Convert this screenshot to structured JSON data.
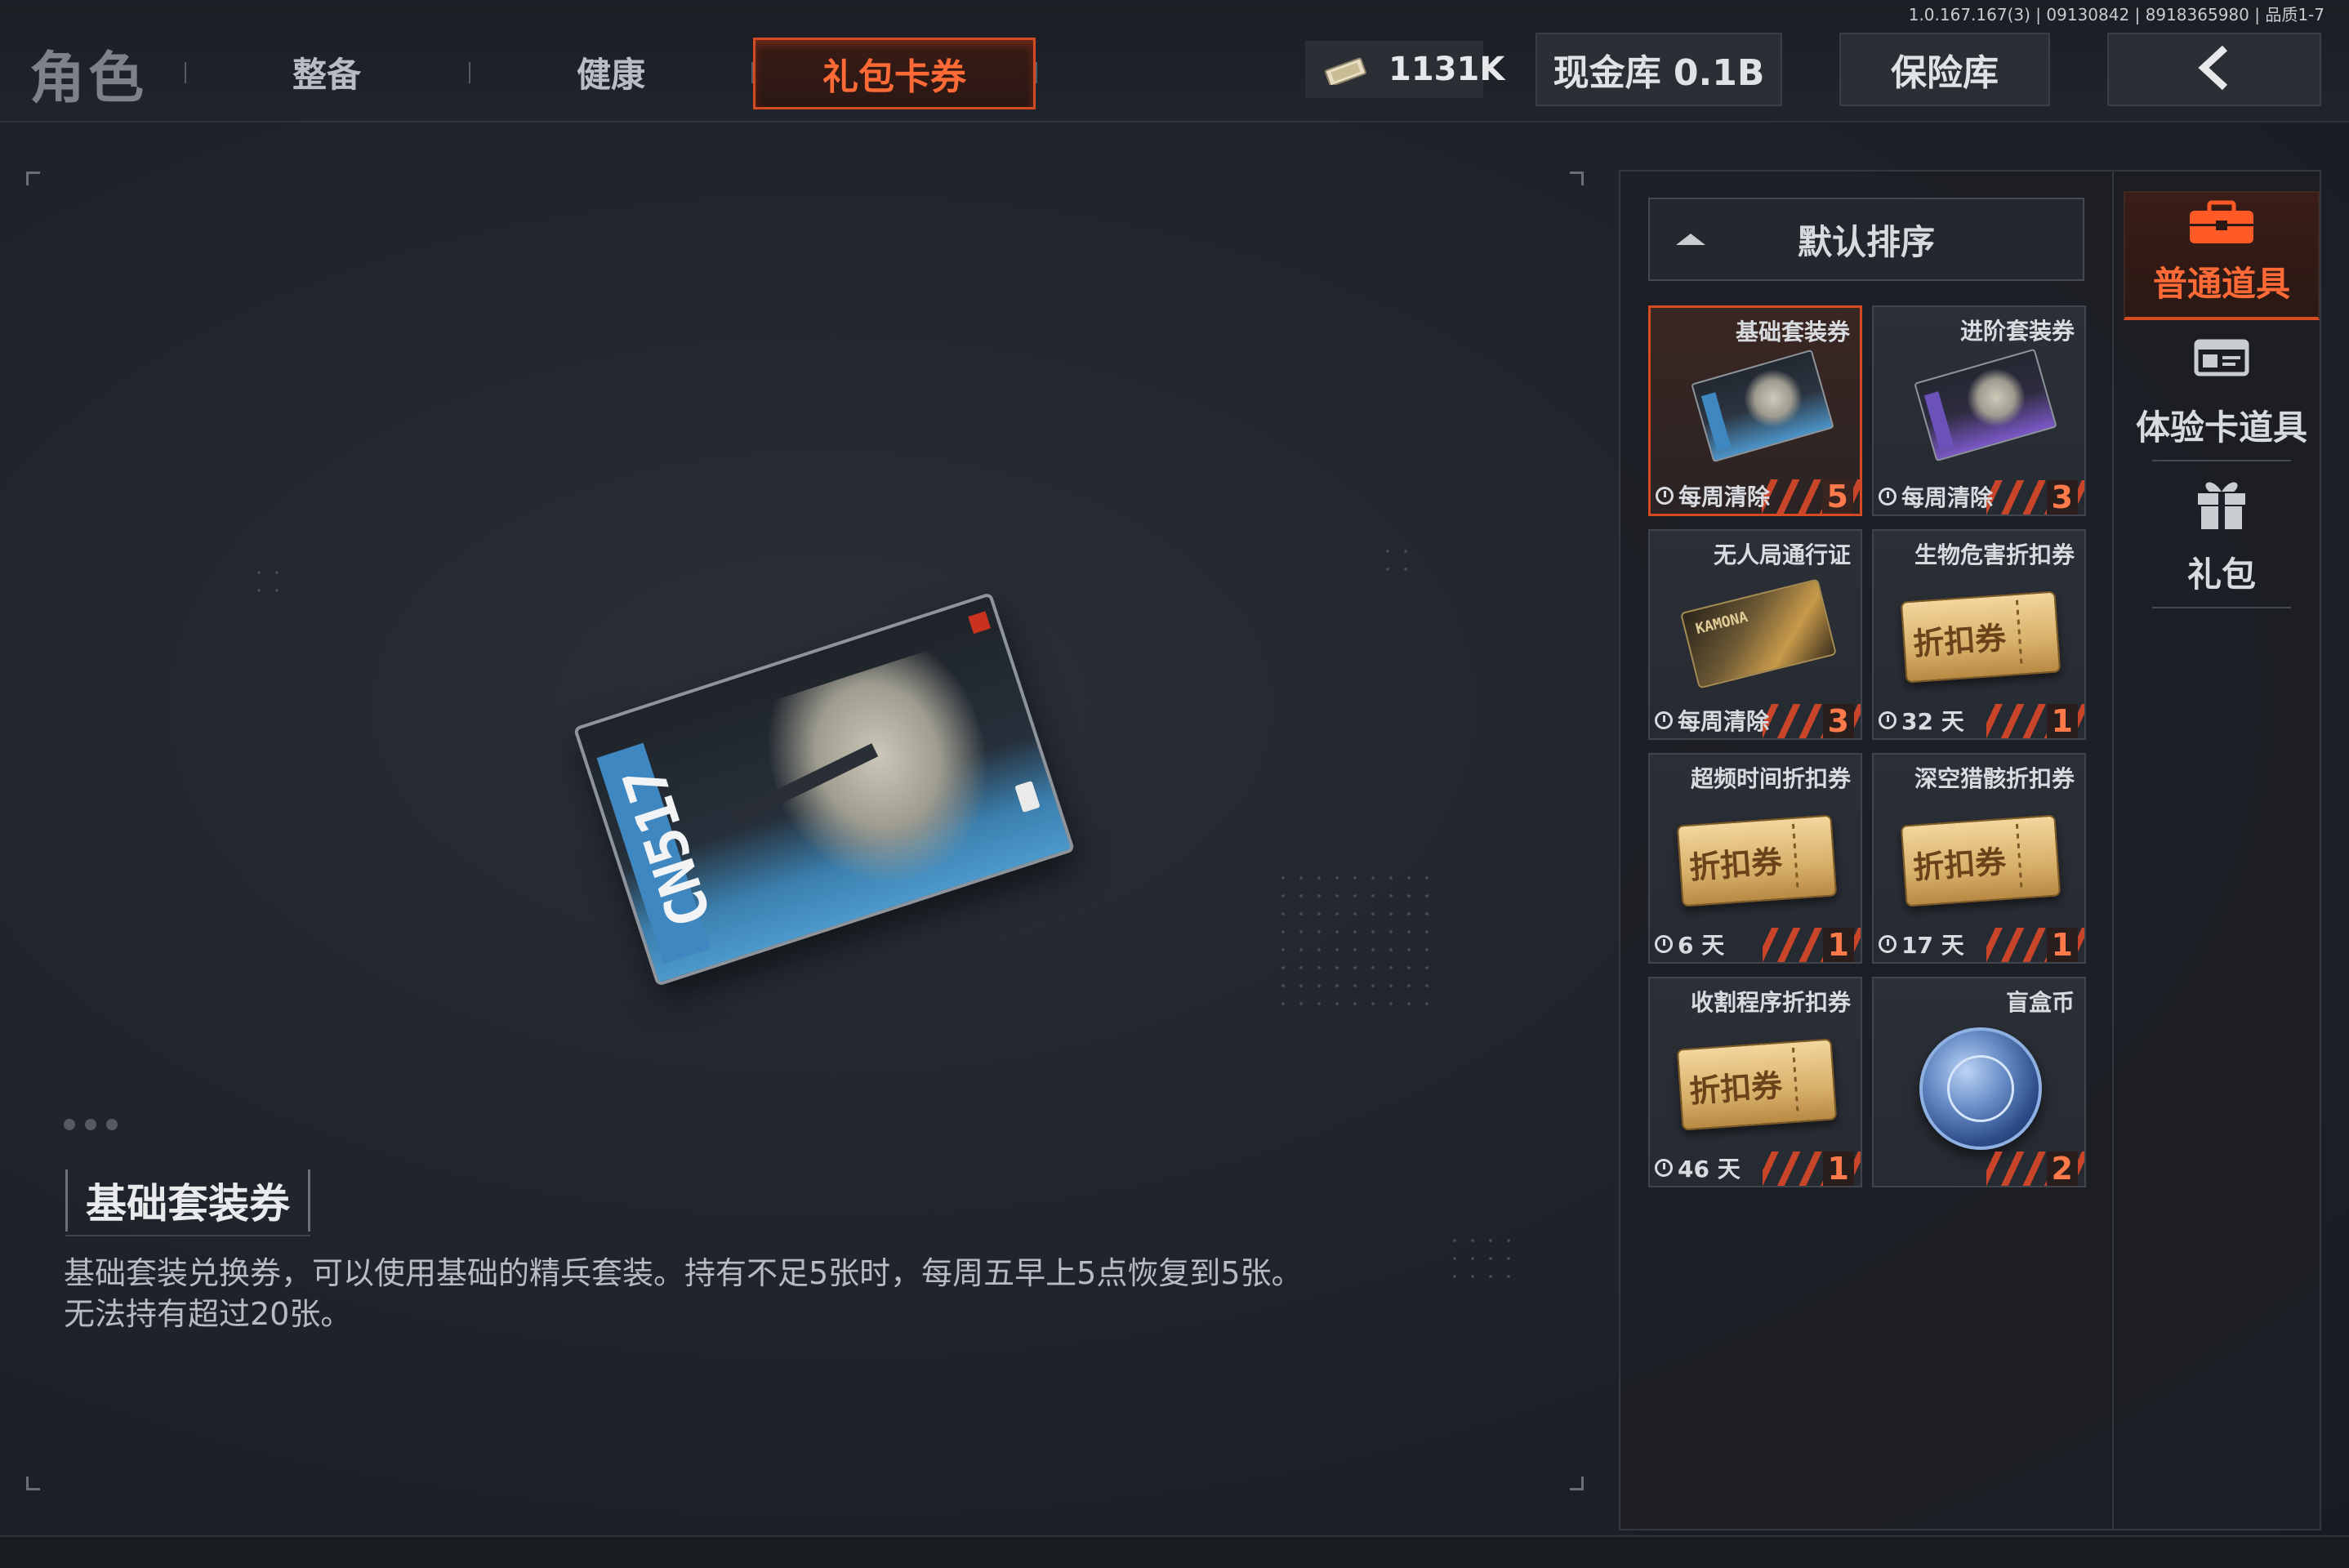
{
  "version_text": "1.0.167.167(3) | 09130842 | 8918365980 | 品质1-7",
  "nav": {
    "role_label": "角色",
    "tabs": [
      {
        "label": "整备"
      },
      {
        "label": "健康"
      },
      {
        "label": "礼包卡券",
        "active": true
      }
    ]
  },
  "header": {
    "currency_value": "1131K",
    "currency_icon": "banknote-icon",
    "cash_vault_label": "现金库 0.1B",
    "safe_label": "保险库",
    "back_icon": "chevron-left-icon"
  },
  "selected_item": {
    "name": "基础套装券",
    "description": "基础套装兑换券，可以使用基础的精兵套装。持有不足5张时，每周五早上5点恢复到5张。无法持有超过20张。",
    "card_text": "CN517"
  },
  "sort": {
    "label": "默认排序"
  },
  "items": [
    {
      "name": "基础套装券",
      "timer": "每周清除",
      "count": "5",
      "art": "card-blue",
      "selected": true
    },
    {
      "name": "进阶套装券",
      "timer": "每周清除",
      "count": "3",
      "art": "card-purple"
    },
    {
      "name": "无人局通行证",
      "timer": "每周清除",
      "count": "3",
      "art": "pass",
      "art_text": "KAMONA"
    },
    {
      "name": "生物危害折扣券",
      "timer": "32 天",
      "count": "1",
      "art": "coupon",
      "art_text": "折扣券"
    },
    {
      "name": "超频时间折扣券",
      "timer": "6 天",
      "count": "1",
      "art": "coupon",
      "art_text": "折扣券"
    },
    {
      "name": "深空猎骸折扣券",
      "timer": "17 天",
      "count": "1",
      "art": "coupon",
      "art_text": "折扣券"
    },
    {
      "name": "收割程序折扣券",
      "timer": "46 天",
      "count": "1",
      "art": "coupon",
      "art_text": "折扣券"
    },
    {
      "name": "盲盒币",
      "timer": "",
      "count": "2",
      "art": "coin"
    }
  ],
  "categories": [
    {
      "label": "普通道具",
      "icon": "toolbox-icon",
      "active": true
    },
    {
      "label": "体验卡道具",
      "icon": "id-card-icon"
    },
    {
      "label": "礼包",
      "icon": "gift-icon"
    }
  ],
  "colors": {
    "accent": "#d44a22",
    "accent_text": "#ff6a36",
    "background": "#1d2129"
  }
}
